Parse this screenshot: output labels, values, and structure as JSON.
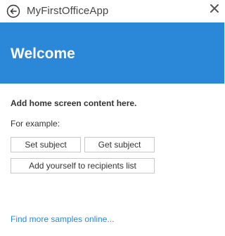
{
  "titlebar": {
    "title": "MyFirstOfficeApp",
    "back_icon": "back-arrow-circle-icon",
    "close_icon": "close-icon"
  },
  "banner": {
    "title": "Welcome",
    "color": "#2b88d8"
  },
  "main": {
    "heading": "Add home screen content here.",
    "example_label": "For example:",
    "buttons": {
      "set_subject": "Set subject",
      "get_subject": "Get subject",
      "add_recipient": "Add yourself to recipients list"
    },
    "link": "Find more samples online..."
  }
}
